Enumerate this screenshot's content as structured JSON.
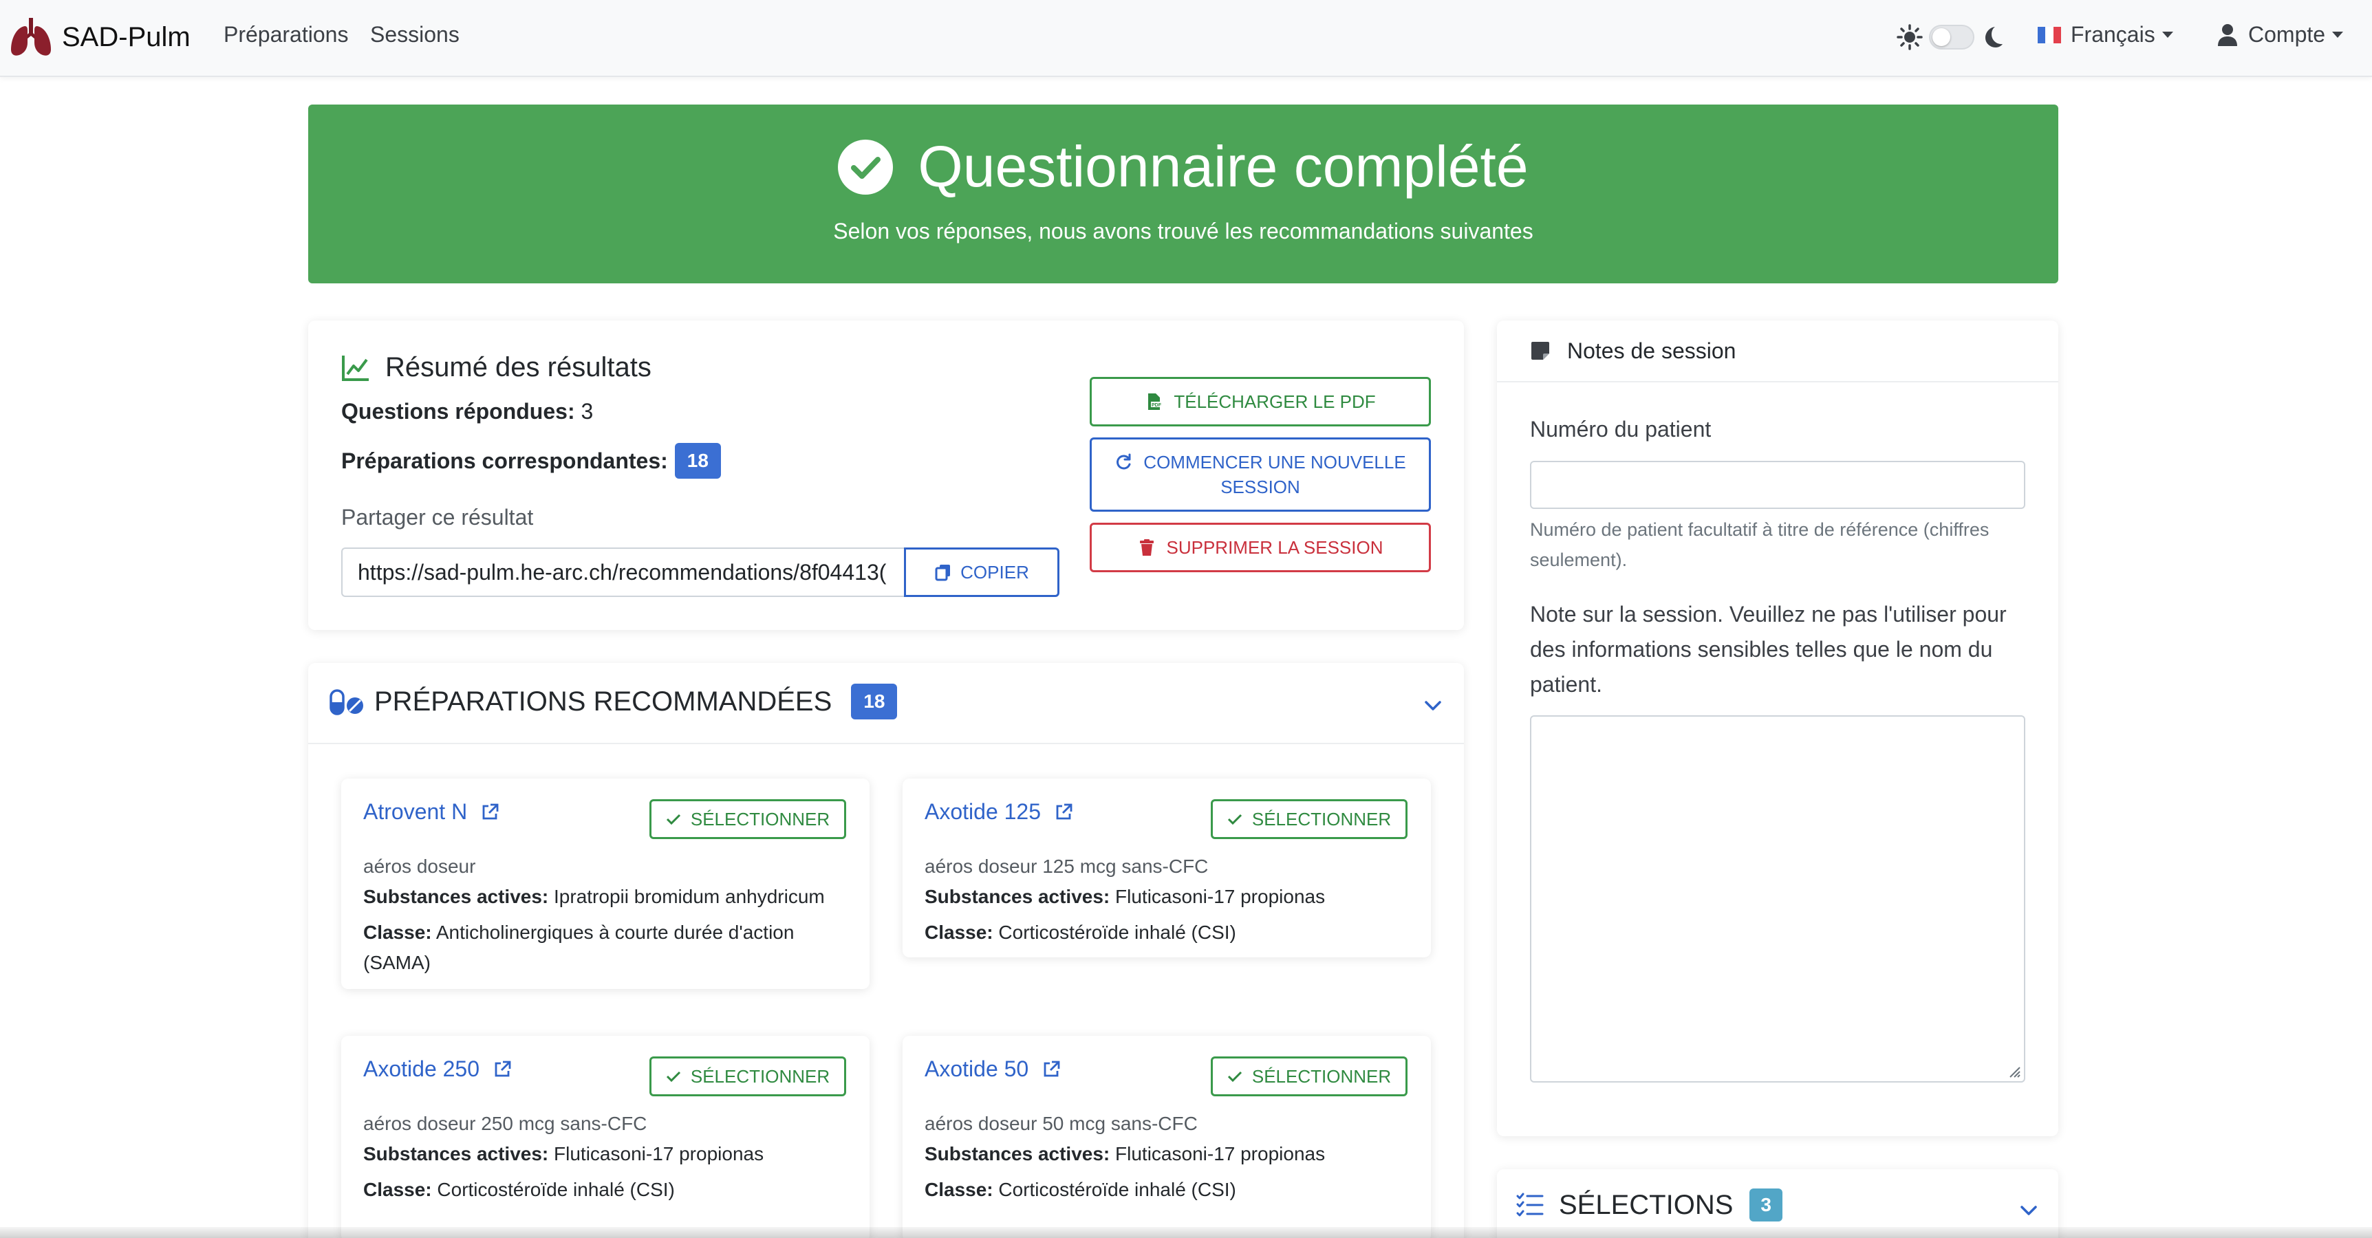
{
  "nav": {
    "brand": "SAD-Pulm",
    "links": [
      "Préparations",
      "Sessions"
    ],
    "language": "Français",
    "account": "Compte"
  },
  "colors": {
    "success": "#4ca457",
    "primary": "#2f63c9",
    "danger": "#d23b46",
    "info_badge": "#52a6c7",
    "brand_logo": "#8b1f2c"
  },
  "hero": {
    "title": "Questionnaire complété",
    "subtitle": "Selon vos réponses, nous avons trouvé les recommandations suivantes"
  },
  "summary": {
    "title": "Résumé des résultats",
    "answered_label": "Questions répondues:",
    "answered_value": "3",
    "matching_label": "Préparations correspondantes:",
    "matching_value": "18",
    "share_label": "Partager ce résultat",
    "share_url": "https://sad-pulm.he-arc.ch/recommendations/8f04413(",
    "copy_label": "COPIER",
    "pdf_label": "TÉLÉCHARGER LE PDF",
    "new_session_line1": "COMMENCER UNE NOUVELLE",
    "new_session_line2": "SESSION",
    "delete_label": "SUPPRIMER LA SESSION"
  },
  "notes": {
    "title": "Notes de session",
    "patient_label": "Numéro du patient",
    "patient_value": "",
    "patient_help": "Numéro de patient facultatif à titre de référence (chiffres seulement).",
    "note_label": "Note sur la session. Veuillez ne pas l'utiliser pour des informations sensibles telles que le nom du patient.",
    "note_value": ""
  },
  "selections": {
    "title": "SÉLECTIONS",
    "count": "3"
  },
  "recommended": {
    "title": "PRÉPARATIONS RECOMMANDÉES",
    "count": "18",
    "select_label": "SÉLECTIONNER",
    "substances_label": "Substances actives:",
    "class_label": "Classe:",
    "items": [
      {
        "name": "Atrovent N",
        "form": "aéros doseur",
        "substances": "Ipratropii bromidum anhydricum",
        "class_line1": "Anticholinergiques à courte durée d'action",
        "class_line2": "(SAMA)"
      },
      {
        "name": "Axotide 125",
        "form": "aéros doseur 125 mcg sans-CFC",
        "substances": "Fluticasoni-17 propionas",
        "class_line1": "Corticostéroïde inhalé (CSI)",
        "class_line2": ""
      },
      {
        "name": "Axotide 250",
        "form": "aéros doseur 250 mcg sans-CFC",
        "substances": "Fluticasoni-17 propionas",
        "class_line1": "Corticostéroïde inhalé (CSI)",
        "class_line2": ""
      },
      {
        "name": "Axotide 50",
        "form": "aéros doseur 50 mcg sans-CFC",
        "substances": "Fluticasoni-17 propionas",
        "class_line1": "Corticostéroïde inhalé (CSI)",
        "class_line2": ""
      }
    ]
  }
}
